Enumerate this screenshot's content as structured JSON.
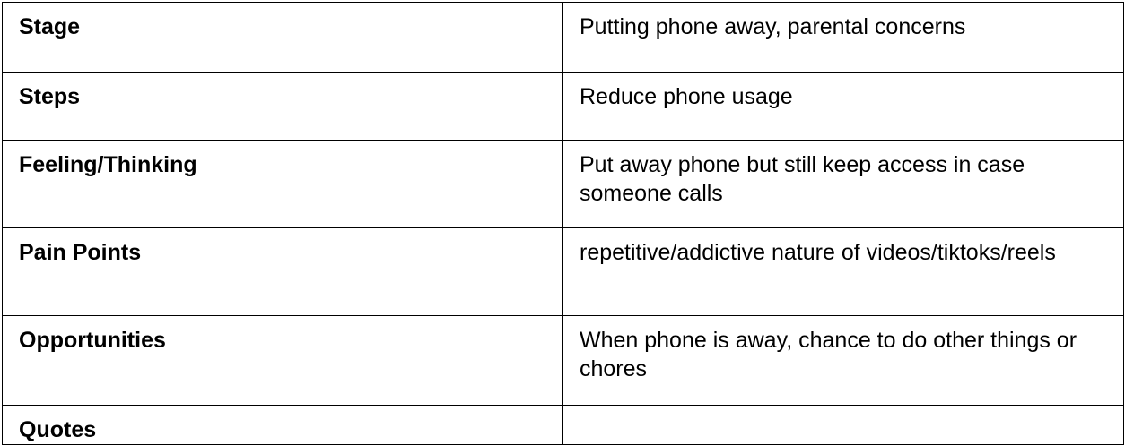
{
  "rows": [
    {
      "label": "Stage",
      "value": "Putting phone away, parental concerns"
    },
    {
      "label": "Steps",
      "value": "Reduce phone usage"
    },
    {
      "label": "Feeling/Thinking",
      "value": "Put away phone but still keep access in case someone calls"
    },
    {
      "label": "Pain Points",
      "value": "repetitive/addictive nature of videos/tiktoks/reels"
    },
    {
      "label": "Opportunities",
      "value": "When phone is away, chance to do other things or chores"
    },
    {
      "label": "Quotes",
      "value": ""
    }
  ]
}
